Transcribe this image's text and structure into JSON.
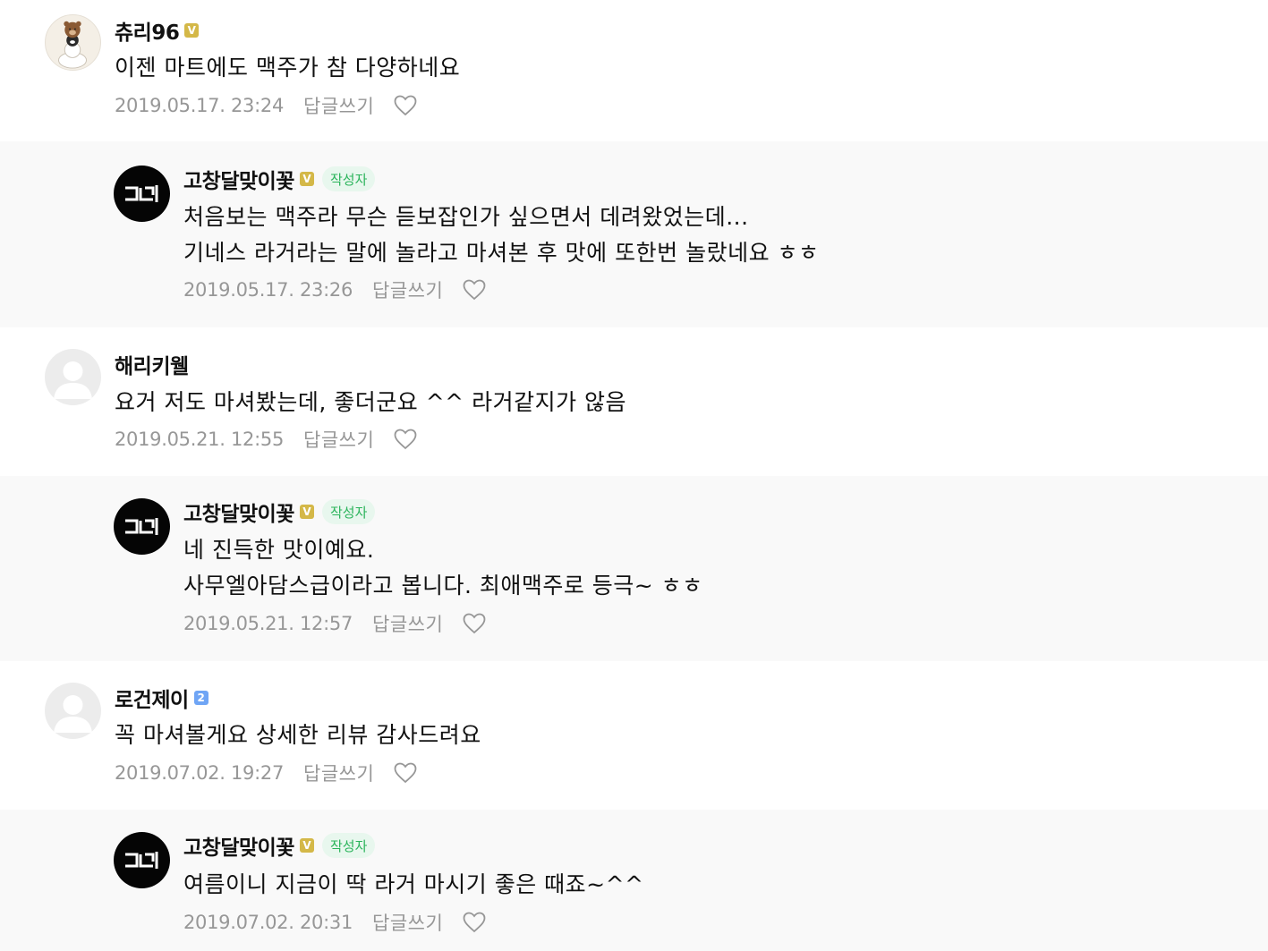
{
  "reply_label": "답글쓰기",
  "author_tag": "작성자",
  "comments": [
    {
      "nickname": "츄리96",
      "badge": "V",
      "lines": [
        "이젠 마트에도 맥주가 참 다양하네요"
      ],
      "date": "2019.05.17. 23:24"
    },
    {
      "nickname": "고창달맞이꽃",
      "badge": "V",
      "lines": [
        "처음보는 맥주라 무슨 듣보잡인가 싶으면서 데려왔었는데...",
        "기네스 라거라는 말에 놀라고 마셔본 후 맛에 또한번 놀랐네요 ㅎㅎ"
      ],
      "date": "2019.05.17. 23:26"
    },
    {
      "nickname": "해리키웰",
      "lines": [
        "요거 저도 마셔봤는데, 좋더군요 ^^ 라거같지가 않음"
      ],
      "date": "2019.05.21. 12:55"
    },
    {
      "nickname": "고창달맞이꽃",
      "badge": "V",
      "lines": [
        "네 진득한 맛이예요.",
        "사무엘아담스급이라고 봅니다. 최애맥주로 등극~ ㅎㅎ"
      ],
      "date": "2019.05.21. 12:57"
    },
    {
      "nickname": "로건제이",
      "badge": "2",
      "lines": [
        "꼭 마셔볼게요 상세한 리뷰 감사드려요"
      ],
      "date": "2019.07.02. 19:27"
    },
    {
      "nickname": "고창달맞이꽃",
      "badge": "V",
      "lines": [
        "여름이니 지금이 딱 라거 마시기 좋은 때죠~^^"
      ],
      "date": "2019.07.02. 20:31"
    }
  ],
  "colors": {
    "reply_background": "#f9f9f9",
    "meta_text": "#979797",
    "author_tag_text": "#2bb45b",
    "author_tag_bg": "#e8f7ee",
    "badge_v": "#d4b848",
    "badge_level": "#6fa5f5"
  },
  "icons": {
    "like": "heart-outline-icon",
    "badge": "verified-badge-icon"
  }
}
